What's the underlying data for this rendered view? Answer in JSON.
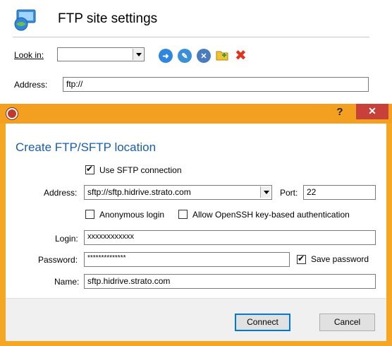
{
  "outer": {
    "title": "FTP site settings",
    "look_in_label": "Look in:",
    "look_in_value": "",
    "address_label": "Address:",
    "address_value": "ftp://"
  },
  "dialog": {
    "help_glyph": "?",
    "close_glyph": "✕",
    "heading": "Create FTP/SFTP location",
    "use_sftp_label": "Use SFTP connection",
    "use_sftp_checked": true,
    "address_label": "Address:",
    "address_value": "sftp://sftp.hidrive.strato.com",
    "port_label": "Port:",
    "port_value": "22",
    "anonymous_label": "Anonymous login",
    "openssh_label": "Allow OpenSSH key-based authentication",
    "login_label": "Login:",
    "login_value": "xxxxxxxxxxxx",
    "password_label": "Password:",
    "password_value": "**************",
    "save_password_label": "Save password",
    "name_label": "Name:",
    "name_value": "sftp.hidrive.strato.com",
    "connect_label": "Connect",
    "cancel_label": "Cancel"
  },
  "colors": {
    "accent": "#1a5dab",
    "frame": "#f3a021",
    "close": "#c7403a"
  }
}
